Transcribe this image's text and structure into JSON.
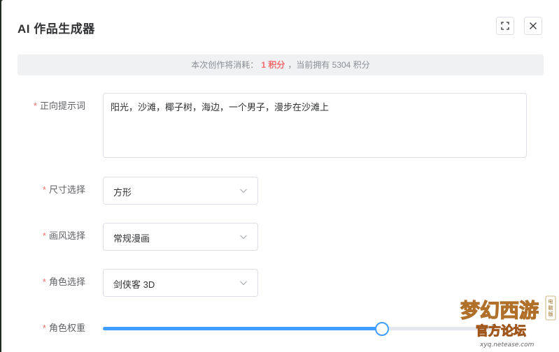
{
  "dialog": {
    "title": "AI 作品生成器"
  },
  "notice": {
    "prefix": "本次创作将消耗：",
    "cost": "1 积分",
    "suffix": "，当前拥有 5304 积分"
  },
  "form": {
    "required_mark": "*",
    "prompt": {
      "label": "正向提示词",
      "value": "阳光，沙滩，椰子树，海边，一个男子，漫步在沙滩上"
    },
    "size": {
      "label": "尺寸选择",
      "value": "方形"
    },
    "style": {
      "label": "画风选择",
      "value": "常规漫画"
    },
    "role": {
      "label": "角色选择",
      "value": "剑侠客 3D"
    },
    "weight": {
      "label": "角色权重",
      "value": "1",
      "fraction": 0.71
    }
  },
  "watermark": {
    "line1": "梦幻西游",
    "badge": "电脑版",
    "line2": "官方论坛",
    "url": "xyq.netease.com"
  },
  "colors": {
    "required": "#f56c6c",
    "accent": "#409eff",
    "notice_bg": "#f0f1f2"
  },
  "icons": {
    "fullscreen": "fullscreen-icon",
    "close": "close-icon",
    "chevron": "chevron-down-icon"
  }
}
